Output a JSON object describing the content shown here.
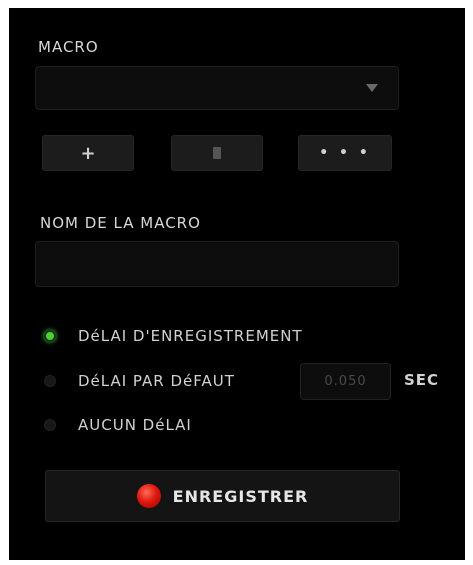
{
  "macro_section": {
    "label": "MACRO",
    "selected_value": ""
  },
  "macro_buttons": {
    "add": "+",
    "more": "• • •"
  },
  "name_section": {
    "label": "NOM DE LA MACRO",
    "value": ""
  },
  "delay_options": [
    {
      "label": "DéLAI D'ENREGISTREMENT",
      "selected": true
    },
    {
      "label": "DéLAI PAR DéFAUT",
      "selected": false
    },
    {
      "label": "AUCUN DéLAI",
      "selected": false
    }
  ],
  "default_delay": {
    "value": "0.050",
    "unit": "SEC"
  },
  "record_button": {
    "label": "ENREGISTRER"
  },
  "colors": {
    "selected_radio": "#44d62c",
    "record_dot": "#e0190f"
  }
}
